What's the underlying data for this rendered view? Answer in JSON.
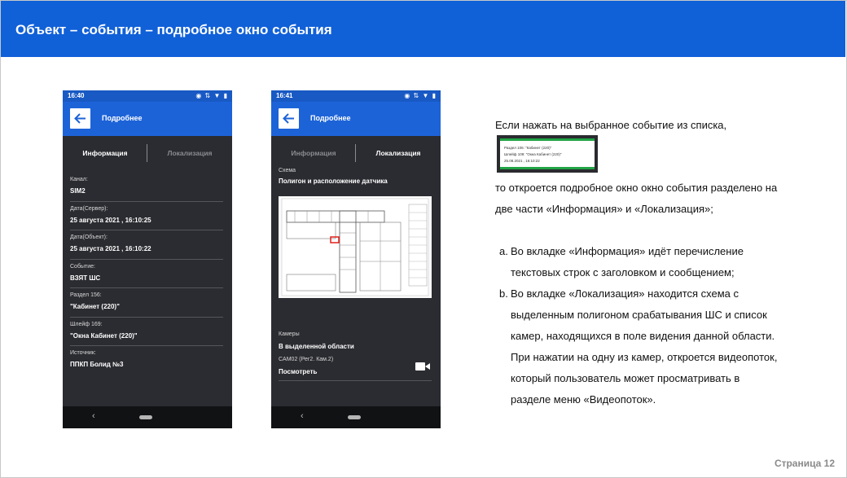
{
  "header": {
    "title": "Объект – события – подробное окно события"
  },
  "phone1": {
    "time": "16:40",
    "status_icons": "◉ ⇅ ▼ ▮",
    "appbar_title": "Подробнее",
    "tabs": [
      {
        "label": "Информация",
        "active": true
      },
      {
        "label": "Локализация",
        "active": false
      }
    ],
    "fields": [
      {
        "label": "Канал:",
        "value": "SIM2"
      },
      {
        "label": "Дата(Сервер):",
        "value": "25 августа 2021 , 16:10:25"
      },
      {
        "label": "Дата(Объект):",
        "value": "25 августа 2021 , 16:10:22"
      },
      {
        "label": "Событие:",
        "value": "ВЗЯТ ШС"
      },
      {
        "label": "Раздел 156:",
        "value": "\"Кабинет (220)\""
      },
      {
        "label": "Шлейф 169:",
        "value": "\"Окна Кабинет (220)\""
      },
      {
        "label": "Источник:",
        "value": "ППКП Болид №3"
      }
    ],
    "nav_back": "‹"
  },
  "phone2": {
    "time": "16:41",
    "status_icons": "◉ ⇅ ▼ ▮",
    "appbar_title": "Подробнее",
    "tabs": [
      {
        "label": "Информация",
        "active": false
      },
      {
        "label": "Локализация",
        "active": true
      }
    ],
    "schema_label": "Схема",
    "schema_value": "Полигон и расположение датчика",
    "cameras_label": "Камеры",
    "cameras_value": "В выделенной области",
    "camera_name": "CAM02 (Рег2. Кам.2)",
    "camera_link": "Посмотреть",
    "nav_back": "‹"
  },
  "thumbnail": {
    "line1": "Раздел 106: \"Кабинет (220)\"",
    "line2": "Шлейф 109: \"Окна Кабинет (220)\"",
    "line3": "25.08.2021 , 16:10:22"
  },
  "description": {
    "intro": "Если нажать на выбранное событие из списка,",
    "line2": "то откроется подробное окно окно события разделено на",
    "line3": "две части «Информация» и «Локализация»;",
    "item_a_marker": "a.",
    "item_a": [
      "Во вкладке «Информация» идёт перечисление",
      "текстовых строк с заголовком и сообщением;"
    ],
    "item_b_marker": "b.",
    "item_b": [
      "Во вкладке «Локализация» находится схема с",
      "выделенным полигоном срабатывания ШС и список",
      "камер, находящихся в поле видения данной области.",
      "При нажатии на одну из камер, откроется видеопоток,",
      "который пользователь может просматривать в",
      "разделе меню «Видеопоток»."
    ]
  },
  "footer": {
    "page_label": "Страница 12"
  }
}
